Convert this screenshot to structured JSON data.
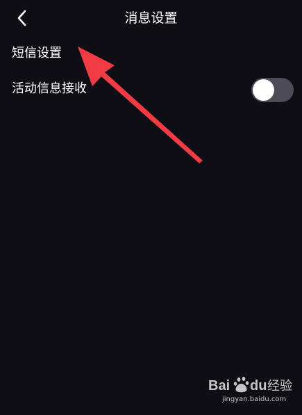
{
  "header": {
    "title": "消息设置",
    "back_icon": "chevron-left-icon"
  },
  "settings": [
    {
      "label": "短信设置"
    },
    {
      "label": "活动信息接收",
      "toggle_on": false
    }
  ],
  "colors": {
    "background": "#0f0e14",
    "text": "#ffffff",
    "toggle_track": "#4c4b57",
    "toggle_knob": "#ffffff",
    "annotation_arrow": "#f23b45"
  },
  "watermark": {
    "logo": "Bai du 经验",
    "url": "jingyan.baidu.com"
  }
}
